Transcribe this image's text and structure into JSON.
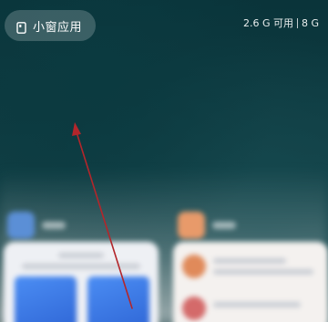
{
  "small_window": {
    "label": "小窗应用",
    "icon": "small-window-icon"
  },
  "memory": {
    "available": "2.6 G 可用",
    "total": "8 G"
  },
  "recent_apps": [
    {
      "icon": "app-icon-blue",
      "color": "#5b8fd6"
    },
    {
      "icon": "app-icon-orange",
      "color": "#e89a6a"
    }
  ],
  "gesture_arrow": {
    "color": "#b3262b"
  }
}
